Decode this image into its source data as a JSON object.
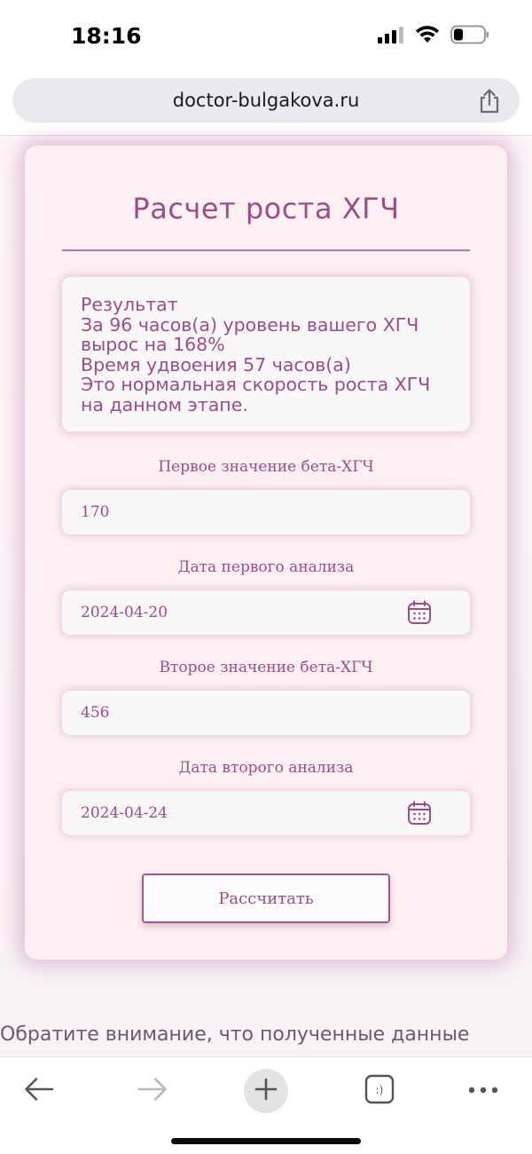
{
  "status_bar": {
    "time": "18:16",
    "icons": [
      "signal-icon",
      "wifi-icon",
      "battery-icon"
    ]
  },
  "browser": {
    "url": "doctor-bulgakova.ru"
  },
  "calculator": {
    "title": "Расчет роста ХГЧ",
    "result_lines": [
      "Результат",
      "За 96 часов(а) уровень вашего ХГЧ",
      "вырос на 168%",
      "Время удвоения 57 часов(а)",
      "Это нормальная скорость роста ХГЧ",
      "на данном этапе."
    ],
    "first_value_label": "Первое значение бета-ХГЧ",
    "first_value": "170",
    "first_date_label": "Дата первого анализа",
    "first_date": "2024-04-20",
    "second_value_label": "Второе значение бета-ХГЧ",
    "second_value": "456",
    "second_date_label": "Дата второго анализа",
    "second_date": "2024-04-24",
    "calculate_label": "Рассчитать"
  },
  "notice": "Обратите внимание, что полученные данные",
  "colors": {
    "accent": "#9b4d88",
    "card_bg": "#fdf0f2",
    "field_bg": "#faf7f8"
  },
  "toolbar": {
    "icons": [
      "back-arrow-icon",
      "forward-arrow-icon",
      "new-tab-plus-icon",
      "tabs-icon",
      "more-icon"
    ]
  }
}
